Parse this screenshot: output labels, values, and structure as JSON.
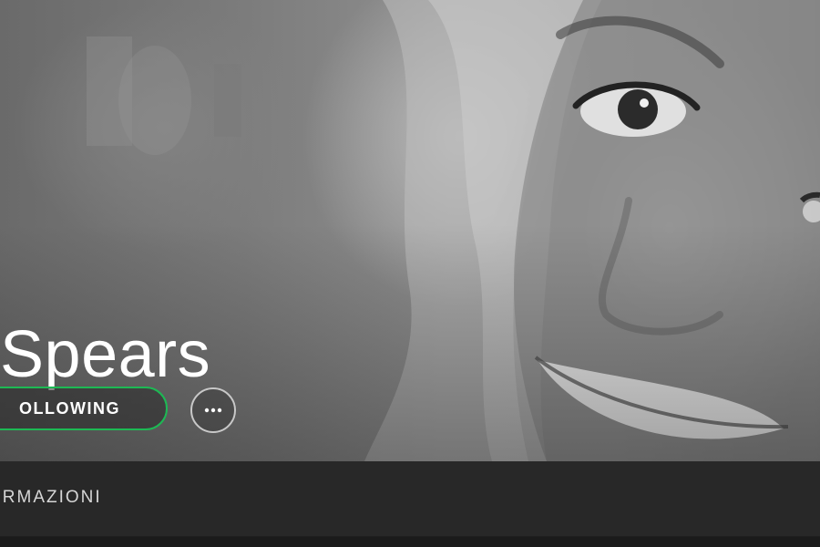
{
  "artist": {
    "name": "Spears"
  },
  "actions": {
    "follow_label": "OLLOWING",
    "more_icon": "more-horizontal-icon"
  },
  "tabs": [
    {
      "label": "ORMAZIONI"
    }
  ],
  "colors": {
    "accent": "#1db954",
    "tab_bar_bg": "#282828",
    "page_bg": "#181818",
    "text": "#ffffff"
  }
}
